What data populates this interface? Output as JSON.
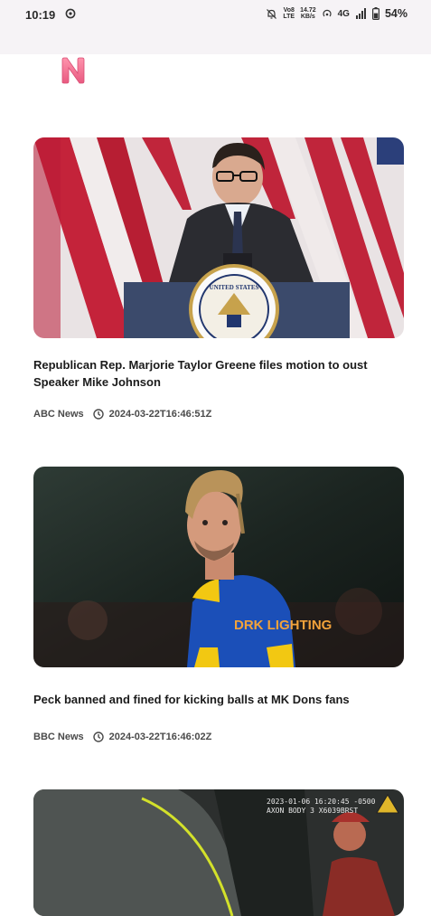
{
  "status_bar": {
    "time": "10:19",
    "volte_top": "Vo8",
    "volte_bottom": "LTE",
    "speed_value": "14.72",
    "speed_unit": "KB/s",
    "network": "4G",
    "battery": "54%"
  },
  "app": {
    "logo_letter": "N",
    "accent_color": "#f06e8f"
  },
  "articles": [
    {
      "title": "Republican Rep. Marjorie Taylor Greene files motion to oust Speaker Mike Johnson",
      "source": "ABC News",
      "timestamp": "2024-03-22T16:46:51Z",
      "image_label": "UNITED STATES"
    },
    {
      "title": "Peck banned and fined for kicking balls at MK Dons fans",
      "source": "BBC News",
      "timestamp": "2024-03-22T16:46:02Z",
      "image_label": "DRK LIGHTING"
    },
    {
      "image_overlay_line1": "2023-01-06 16:20:45 -0500",
      "image_overlay_line2": "AXON BODY 3 X6039BRST"
    }
  ]
}
